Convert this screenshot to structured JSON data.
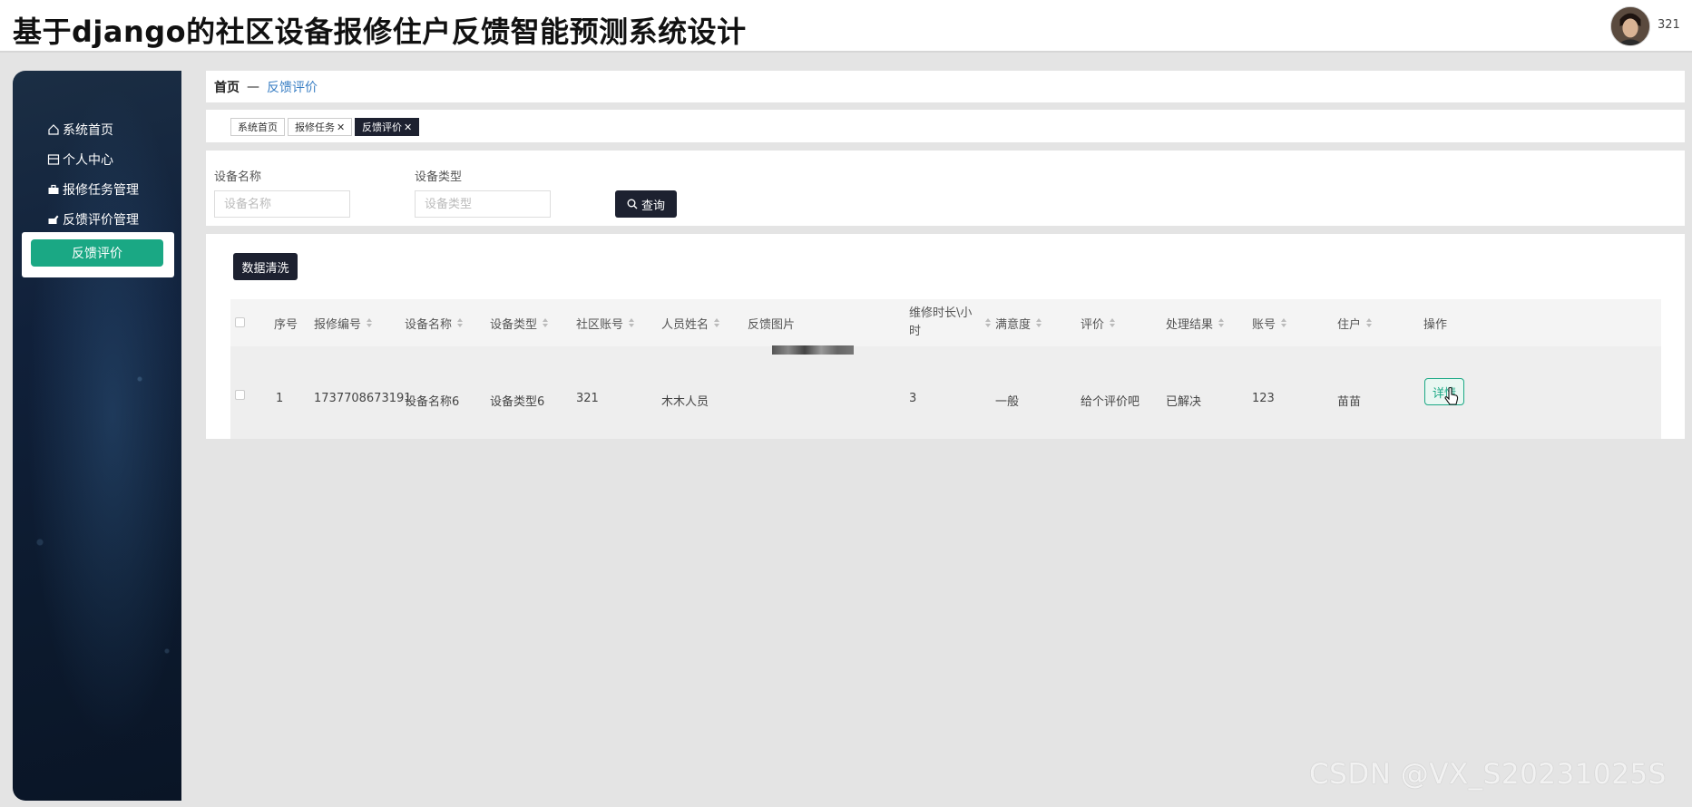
{
  "header": {
    "title": "基于django的社区设备报修住户反馈智能预测系统设计",
    "username": "321",
    "avatar_icon": "user-avatar"
  },
  "sidebar": {
    "items": [
      {
        "label": "系统首页",
        "icon": "home-icon"
      },
      {
        "label": "个人中心",
        "icon": "profile-icon"
      },
      {
        "label": "报修任务管理",
        "icon": "briefcase-icon"
      },
      {
        "label": "反馈评价管理",
        "icon": "feedback-icon"
      }
    ],
    "submenu_active": "反馈评价",
    "accent": "#1aa884"
  },
  "breadcrumb": {
    "home": "首页",
    "separator": "—",
    "current": "反馈评价"
  },
  "tabs": [
    {
      "label": "系统首页",
      "closable": false
    },
    {
      "label": "报修任务",
      "closable": true
    },
    {
      "label": "反馈评价",
      "closable": true,
      "active": true
    }
  ],
  "search": {
    "name_label": "设备名称",
    "name_placeholder": "设备名称",
    "type_label": "设备类型",
    "type_placeholder": "设备类型",
    "button": "查询"
  },
  "actions": {
    "clean_button": "数据清洗"
  },
  "table": {
    "columns": [
      "序号",
      "报修编号",
      "设备名称",
      "设备类型",
      "社区账号",
      "人员姓名",
      "反馈图片",
      "维修时长\\小时",
      "满意度",
      "评价",
      "处理结果",
      "账号",
      "住户",
      "操作"
    ],
    "rows": [
      {
        "index": "1",
        "repair_no": "1737708673191",
        "device_name": "设备名称6",
        "device_type": "设备类型6",
        "community_account": "321",
        "staff_name": "木木人员",
        "repair_hours": "3",
        "satisfaction": "一般",
        "comment": "给个评价吧",
        "result": "已解决",
        "account": "123",
        "resident": "苗苗",
        "op_label": "详情"
      }
    ]
  },
  "watermark": "CSDN @VX_S20231025S"
}
